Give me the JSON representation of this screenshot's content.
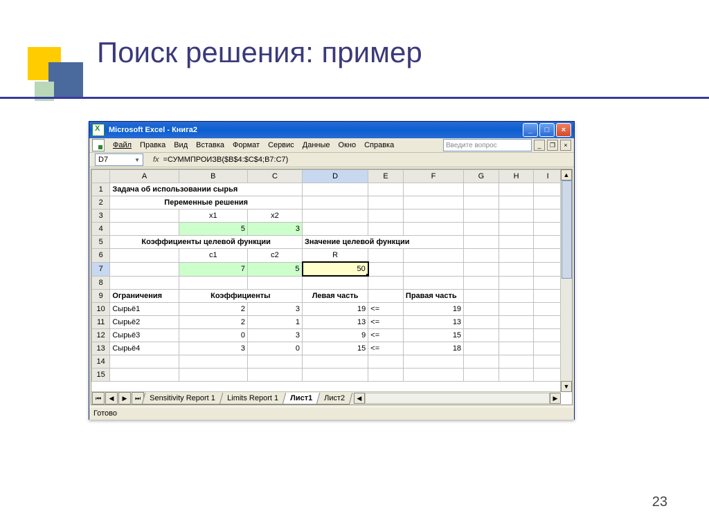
{
  "slide": {
    "title": "Поиск решения: пример",
    "page_number": "23"
  },
  "window": {
    "title": "Microsoft Excel - Книга2",
    "menus": [
      "Файл",
      "Правка",
      "Вид",
      "Вставка",
      "Формат",
      "Сервис",
      "Данные",
      "Окно",
      "Справка"
    ],
    "question_placeholder": "Введите вопрос",
    "status": "Готово"
  },
  "formula_bar": {
    "cell_ref": "D7",
    "fx_label": "fx",
    "formula": "=СУММПРОИЗВ($B$4:$C$4;B7:C7)"
  },
  "columns": [
    "A",
    "B",
    "C",
    "D",
    "E",
    "F",
    "G",
    "H",
    "I"
  ],
  "rows": [
    "1",
    "2",
    "3",
    "4",
    "5",
    "6",
    "7",
    "8",
    "9",
    "10",
    "11",
    "12",
    "13",
    "14",
    "15"
  ],
  "cells": {
    "A1": "Задача об использовании сырья",
    "A2": "Переменные решения",
    "B3": "x1",
    "C3": "x2",
    "B4": "5",
    "C4": "3",
    "A5": "Коэффициенты целевой функции",
    "D5": "Значение целевой функции",
    "B6": "c1",
    "C6": "c2",
    "D6": "R",
    "B7": "7",
    "C7": "5",
    "D7": "50",
    "A9": "Ограничения",
    "B9": "Коэффициенты",
    "D9": "Левая часть",
    "F9": "Правая часть",
    "A10": "Сырьё1",
    "B10": "2",
    "C10": "3",
    "D10": "19",
    "E10": "<=",
    "F10": "19",
    "A11": "Сырьё2",
    "B11": "2",
    "C11": "1",
    "D11": "13",
    "E11": "<=",
    "F11": "13",
    "A12": "Сырьё3",
    "B12": "0",
    "C12": "3",
    "D12": "9",
    "E12": "<=",
    "F12": "15",
    "A13": "Сырьё4",
    "B13": "3",
    "C13": "0",
    "D13": "15",
    "E13": "<=",
    "F13": "18"
  },
  "sheet_tabs": {
    "t1": "Sensitivity Report 1",
    "t2": "Limits Report 1",
    "t3": "Лист1",
    "t4": "Лист2"
  }
}
